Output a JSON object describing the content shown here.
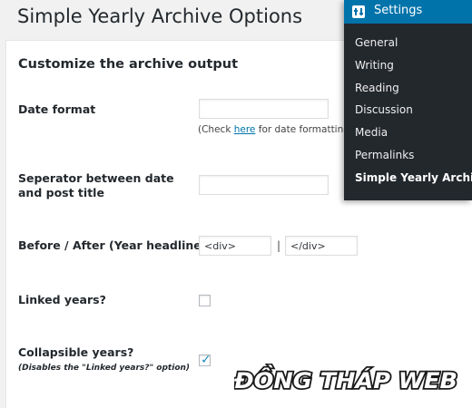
{
  "page": {
    "title": "Simple Yearly Archive Options"
  },
  "section": {
    "title": "Customize the archive output"
  },
  "fields": {
    "date_format": {
      "label": "Date format",
      "value": "",
      "description_prefix": "(Check ",
      "description_link": "here",
      "description_suffix": " for date formatting)"
    },
    "separator": {
      "label": "Seperator between date and post title",
      "value": ""
    },
    "before_after": {
      "label": "Before / After (Year headline)",
      "before_value": "<div>",
      "separator": "|",
      "after_value": "</div>"
    },
    "linked_years": {
      "label": "Linked years?",
      "checked": false
    },
    "collapsible_years": {
      "label": "Collapsible years?",
      "hint": "(Disables the \"Linked years?\" option)",
      "checked": true
    }
  },
  "menu": {
    "header": {
      "label": "Settings",
      "icon": "settings-icon"
    },
    "items": [
      {
        "label": "General"
      },
      {
        "label": "Writing"
      },
      {
        "label": "Reading"
      },
      {
        "label": "Discussion"
      },
      {
        "label": "Media"
      },
      {
        "label": "Permalinks"
      },
      {
        "label": "Simple Yearly Archive",
        "current": true
      }
    ]
  },
  "watermark": {
    "text": "ĐỒNG THÁP WEB"
  },
  "colors": {
    "accent": "#0073aa",
    "menu_bg": "#23282d",
    "link": "#0073aa",
    "checkmark": "#1e8cbe"
  }
}
